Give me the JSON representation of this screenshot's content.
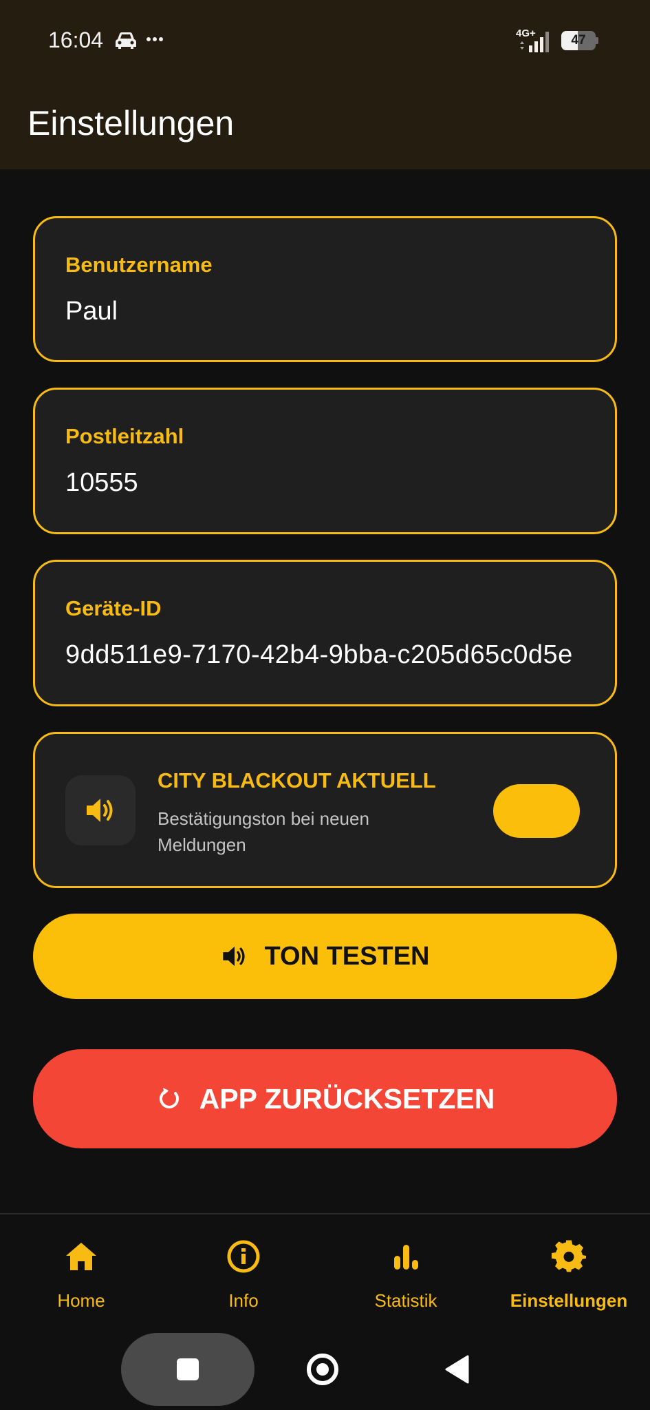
{
  "status_bar": {
    "time": "16:04",
    "network": "4G+",
    "battery": "47",
    "battery_fraction": 0.47,
    "icons": [
      "car-icon",
      "more-dots-icon",
      "signal-icon",
      "battery-icon"
    ]
  },
  "header": {
    "title": "Einstellungen"
  },
  "fields": [
    {
      "label": "Benutzername",
      "value": "Paul"
    },
    {
      "label": "Postleitzahl",
      "value": "10555"
    },
    {
      "label": "Geräte-ID",
      "value": "9dd511e9-7170-42b4-9bba-c205d65c0d5e"
    }
  ],
  "sound_setting": {
    "title": "CITY BLACKOUT AKTUELL",
    "description": "Bestätigungston bei neuen Meldungen",
    "icon": "speaker-icon",
    "enabled": true
  },
  "buttons": {
    "test_sound": {
      "label": "TON TESTEN",
      "icon": "speaker-icon",
      "color": "#fcbf09"
    },
    "reset_app": {
      "label": "APP ZURÜCKSETZEN",
      "icon": "refresh-icon",
      "color": "#f34636"
    }
  },
  "bottom_nav": [
    {
      "label": "Home",
      "icon": "home-icon",
      "active": false
    },
    {
      "label": "Info",
      "icon": "info-icon",
      "active": false
    },
    {
      "label": "Statistik",
      "icon": "stats-icon",
      "active": false
    },
    {
      "label": "Einstellungen",
      "icon": "gear-icon",
      "active": true
    }
  ],
  "colors": {
    "accent": "#f7bb14",
    "danger": "#f34636",
    "background": "#101010",
    "card": "#1f1f1f",
    "header": "#241d10"
  }
}
